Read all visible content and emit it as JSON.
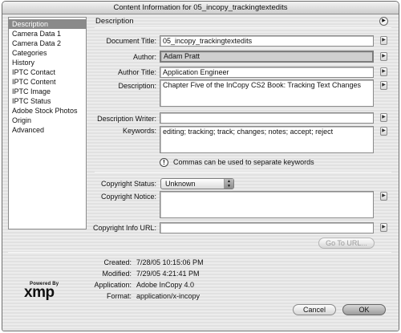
{
  "window": {
    "title": "Content Information for 05_incopy_trackingtextedits"
  },
  "sidebar": {
    "items": [
      {
        "label": "Description",
        "selected": true
      },
      {
        "label": "Camera Data 1"
      },
      {
        "label": "Camera Data 2"
      },
      {
        "label": "Categories"
      },
      {
        "label": "History"
      },
      {
        "label": "IPTC Contact"
      },
      {
        "label": "IPTC Content"
      },
      {
        "label": "IPTC Image"
      },
      {
        "label": "IPTC Status"
      },
      {
        "label": "Adobe Stock Photos"
      },
      {
        "label": "Origin"
      },
      {
        "label": "Advanced"
      }
    ]
  },
  "panel": {
    "title": "Description"
  },
  "form": {
    "document_title": {
      "label": "Document Title:",
      "value": "05_incopy_trackingtextedits"
    },
    "author": {
      "label": "Author:",
      "value": "Adam Pratt"
    },
    "author_title": {
      "label": "Author Title:",
      "value": "Application Engineer"
    },
    "description": {
      "label": "Description:",
      "value": "Chapter Five of the InCopy CS2 Book: Tracking Text Changes"
    },
    "description_writer": {
      "label": "Description Writer:",
      "value": ""
    },
    "keywords": {
      "label": "Keywords:",
      "value": "editing; tracking; track; changes; notes; accept; reject"
    },
    "keywords_hint": "Commas can be used to separate keywords",
    "copyright_status": {
      "label": "Copyright Status:",
      "value": "Unknown"
    },
    "copyright_notice": {
      "label": "Copyright Notice:",
      "value": ""
    },
    "copyright_url": {
      "label": "Copyright Info URL:",
      "value": ""
    },
    "goto_button": "Go To URL..."
  },
  "info": {
    "created": {
      "label": "Created:",
      "value": "7/28/05 10:15:06 PM"
    },
    "modified": {
      "label": "Modified:",
      "value": "7/29/05 4:21:41 PM"
    },
    "application": {
      "label": "Application:",
      "value": "Adobe InCopy 4.0"
    },
    "format": {
      "label": "Format:",
      "value": "application/x-incopy"
    }
  },
  "logo": {
    "small": "Powered By",
    "big": "xmp"
  },
  "buttons": {
    "cancel": "Cancel",
    "ok": "OK"
  },
  "icons": {
    "field_menu": "triangle-right-icon",
    "panel_menu": "circle-arrow-icon",
    "hint": "exclamation-icon",
    "select": "up-down-stepper-icon"
  }
}
